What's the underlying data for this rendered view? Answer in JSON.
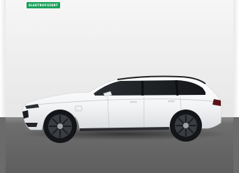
{
  "photo": {
    "badge_label": "ELEKTROFIZIERT",
    "colors": {
      "badge": "#1aa05a",
      "car_body": "#f4f5f6",
      "floor": "#6b6b6b",
      "wall": "#ececec"
    }
  }
}
